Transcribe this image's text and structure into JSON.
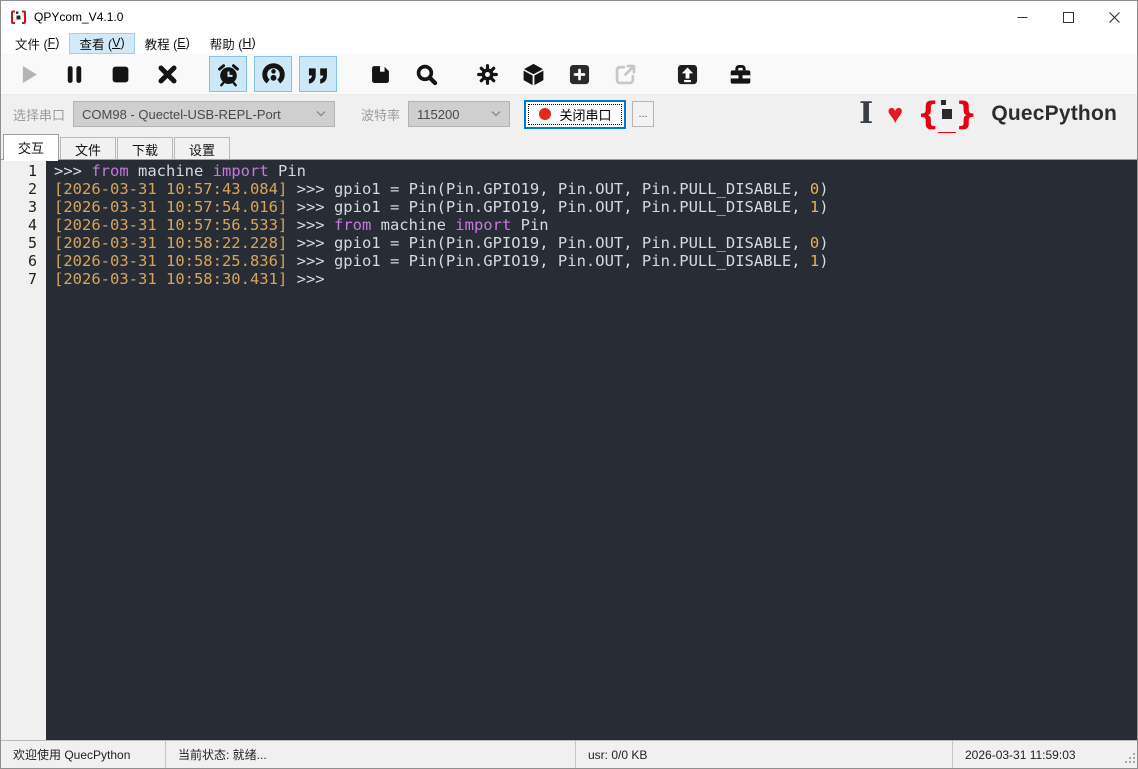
{
  "window": {
    "title": "QPYcom_V4.1.0"
  },
  "menu": {
    "items": [
      {
        "text": "文件",
        "key": "F",
        "active": false
      },
      {
        "text": "查看",
        "key": "V",
        "active": true
      },
      {
        "text": "教程",
        "key": "E",
        "active": false
      },
      {
        "text": "帮助",
        "key": "H",
        "active": false
      }
    ]
  },
  "toolbar": {
    "buttons": [
      {
        "name": "run-button",
        "icon": "play-icon",
        "state": "disabled",
        "gap": 0
      },
      {
        "name": "pause-button",
        "icon": "pause-icon",
        "state": "normal",
        "gap": 8
      },
      {
        "name": "stop-button",
        "icon": "stop-icon",
        "state": "normal",
        "gap": 8
      },
      {
        "name": "clear-button",
        "icon": "cross-icon",
        "state": "normal",
        "gap": 9
      },
      {
        "name": "timestamp-toggle-button",
        "icon": "alarm-clock-icon",
        "state": "toggled",
        "gap": 23
      },
      {
        "name": "hex-mode-toggle-button",
        "icon": "hex-mode-icon",
        "state": "toggled",
        "gap": 7
      },
      {
        "name": "echo-toggle-button",
        "icon": "quotes-icon",
        "state": "toggled",
        "gap": 7
      },
      {
        "name": "save-log-button",
        "icon": "save-icon",
        "state": "normal",
        "gap": 24
      },
      {
        "name": "search-button",
        "icon": "search-icon",
        "state": "normal",
        "gap": 8
      },
      {
        "name": "settings-button",
        "icon": "gear-icon",
        "state": "normal",
        "gap": 23
      },
      {
        "name": "package-button",
        "icon": "package-icon",
        "state": "normal",
        "gap": 8
      },
      {
        "name": "add-button",
        "icon": "plus-square-icon",
        "state": "normal",
        "gap": 8
      },
      {
        "name": "export-button",
        "icon": "export-icon",
        "state": "disabled",
        "gap": 8
      },
      {
        "name": "upload-button",
        "icon": "upload-icon",
        "state": "normal",
        "gap": 24
      },
      {
        "name": "toolbox-button",
        "icon": "toolbox-icon",
        "state": "normal",
        "gap": 15
      }
    ]
  },
  "port_bar": {
    "port_label": "选择串口",
    "port_value": "COM98 - Quectel-USB-REPL-Port",
    "baud_label": "波特率",
    "baud_value": "115200",
    "close_button_label": "关闭串口",
    "more_button_label": "...",
    "brand": {
      "i": "I",
      "heart": "♥",
      "name": "QuecPython"
    }
  },
  "tabs": [
    {
      "label": "交互",
      "active": true
    },
    {
      "label": "文件",
      "active": false
    },
    {
      "label": "下载",
      "active": false
    },
    {
      "label": "设置",
      "active": false
    }
  ],
  "terminal": {
    "lines": [
      {
        "num": "1",
        "segments": [
          {
            "t": ">>> ",
            "c": "plain"
          },
          {
            "t": "from",
            "c": "kw"
          },
          {
            "t": " machine ",
            "c": "plain"
          },
          {
            "t": "import",
            "c": "kw"
          },
          {
            "t": " Pin",
            "c": "plain"
          }
        ]
      },
      {
        "num": "2",
        "segments": [
          {
            "t": "[2026-03-31 10:57:43.084]",
            "c": "ts"
          },
          {
            "t": " >>> gpio1 = Pin(Pin.GPIO19, Pin.OUT, Pin.PULL_DISABLE, ",
            "c": "plain"
          },
          {
            "t": "0",
            "c": "num"
          },
          {
            "t": ")",
            "c": "plain"
          }
        ]
      },
      {
        "num": "3",
        "segments": [
          {
            "t": "[2026-03-31 10:57:54.016]",
            "c": "ts"
          },
          {
            "t": " >>> gpio1 = Pin(Pin.GPIO19, Pin.OUT, Pin.PULL_DISABLE, ",
            "c": "plain"
          },
          {
            "t": "1",
            "c": "num"
          },
          {
            "t": ")",
            "c": "plain"
          }
        ]
      },
      {
        "num": "4",
        "segments": [
          {
            "t": "[2026-03-31 10:57:56.533]",
            "c": "ts"
          },
          {
            "t": " >>> ",
            "c": "plain"
          },
          {
            "t": "from",
            "c": "kw"
          },
          {
            "t": " machine ",
            "c": "plain"
          },
          {
            "t": "import",
            "c": "kw"
          },
          {
            "t": " Pin",
            "c": "plain"
          }
        ]
      },
      {
        "num": "5",
        "segments": [
          {
            "t": "[2026-03-31 10:58:22.228]",
            "c": "ts"
          },
          {
            "t": " >>> gpio1 = Pin(Pin.GPIO19, Pin.OUT, Pin.PULL_DISABLE, ",
            "c": "plain"
          },
          {
            "t": "0",
            "c": "num"
          },
          {
            "t": ")",
            "c": "plain"
          }
        ]
      },
      {
        "num": "6",
        "segments": [
          {
            "t": "[2026-03-31 10:58:25.836]",
            "c": "ts"
          },
          {
            "t": " >>> gpio1 = Pin(Pin.GPIO19, Pin.OUT, Pin.PULL_DISABLE, ",
            "c": "plain"
          },
          {
            "t": "1",
            "c": "num"
          },
          {
            "t": ")",
            "c": "plain"
          }
        ]
      },
      {
        "num": "7",
        "segments": [
          {
            "t": "[2026-03-31 10:58:30.431]",
            "c": "ts"
          },
          {
            "t": " >>>",
            "c": "plain"
          }
        ]
      }
    ]
  },
  "status_bar": {
    "welcome": "欢迎使用 QuecPython",
    "state": "当前状态: 就绪...",
    "usr": "usr: 0/0 KB",
    "time": "2026-03-31 11:59:03"
  },
  "colors": {
    "accent_blue": "#0078d7",
    "toggle_bg": "#cde8f7",
    "heart_red": "#e01b24",
    "brand_red": "#e60012",
    "terminal_bg": "#282d35",
    "timestamp": "#d7a45f",
    "keyword": "#c678dd",
    "number": "#e5b15a",
    "terminal_text": "#d5d9e0"
  }
}
